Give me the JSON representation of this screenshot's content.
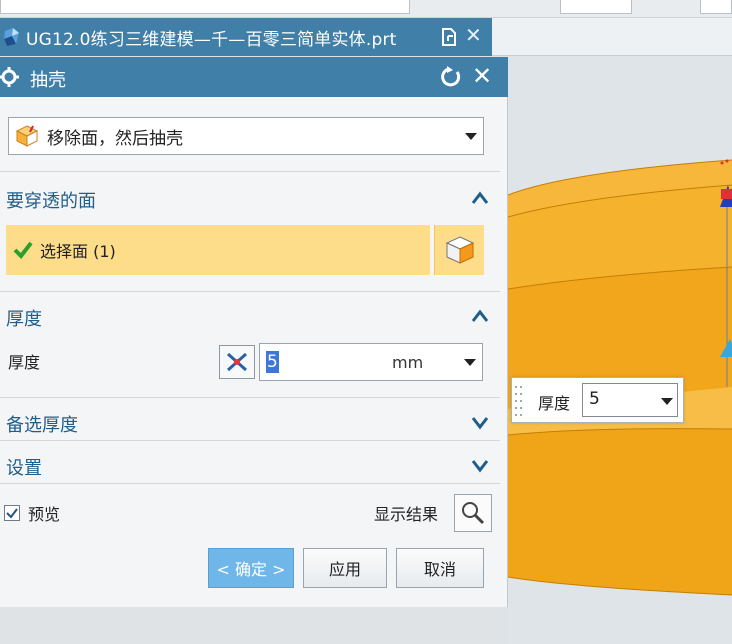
{
  "window": {
    "tab_title": "UG12.0练习三维建模—千—百零三简单实体.prt"
  },
  "dialog": {
    "title": "抽壳",
    "type_selector": {
      "selected": "移除面，然后抽壳"
    },
    "groups": {
      "faces_to_pierce": {
        "title": "要穿透的面",
        "select_label": "选择面 (1)"
      },
      "thickness": {
        "title": "厚度",
        "field_label": "厚度",
        "value": "5",
        "unit": "mm"
      },
      "alternate_thickness": {
        "title": "备选厚度"
      },
      "settings": {
        "title": "设置"
      }
    },
    "preview": {
      "label": "预览",
      "checked": true
    },
    "show_result_label": "显示结果",
    "buttons": {
      "ok": "< 确定 >",
      "apply": "应用",
      "cancel": "取消"
    }
  },
  "floating_field": {
    "label": "厚度",
    "value": "5"
  },
  "colors": {
    "header_blue": "#3f7fa8",
    "group_title_blue": "#1f5e8a",
    "selection_yellow": "#fddc8a",
    "ok_blue": "#6fb6e9",
    "part_orange": "#f5a623"
  }
}
